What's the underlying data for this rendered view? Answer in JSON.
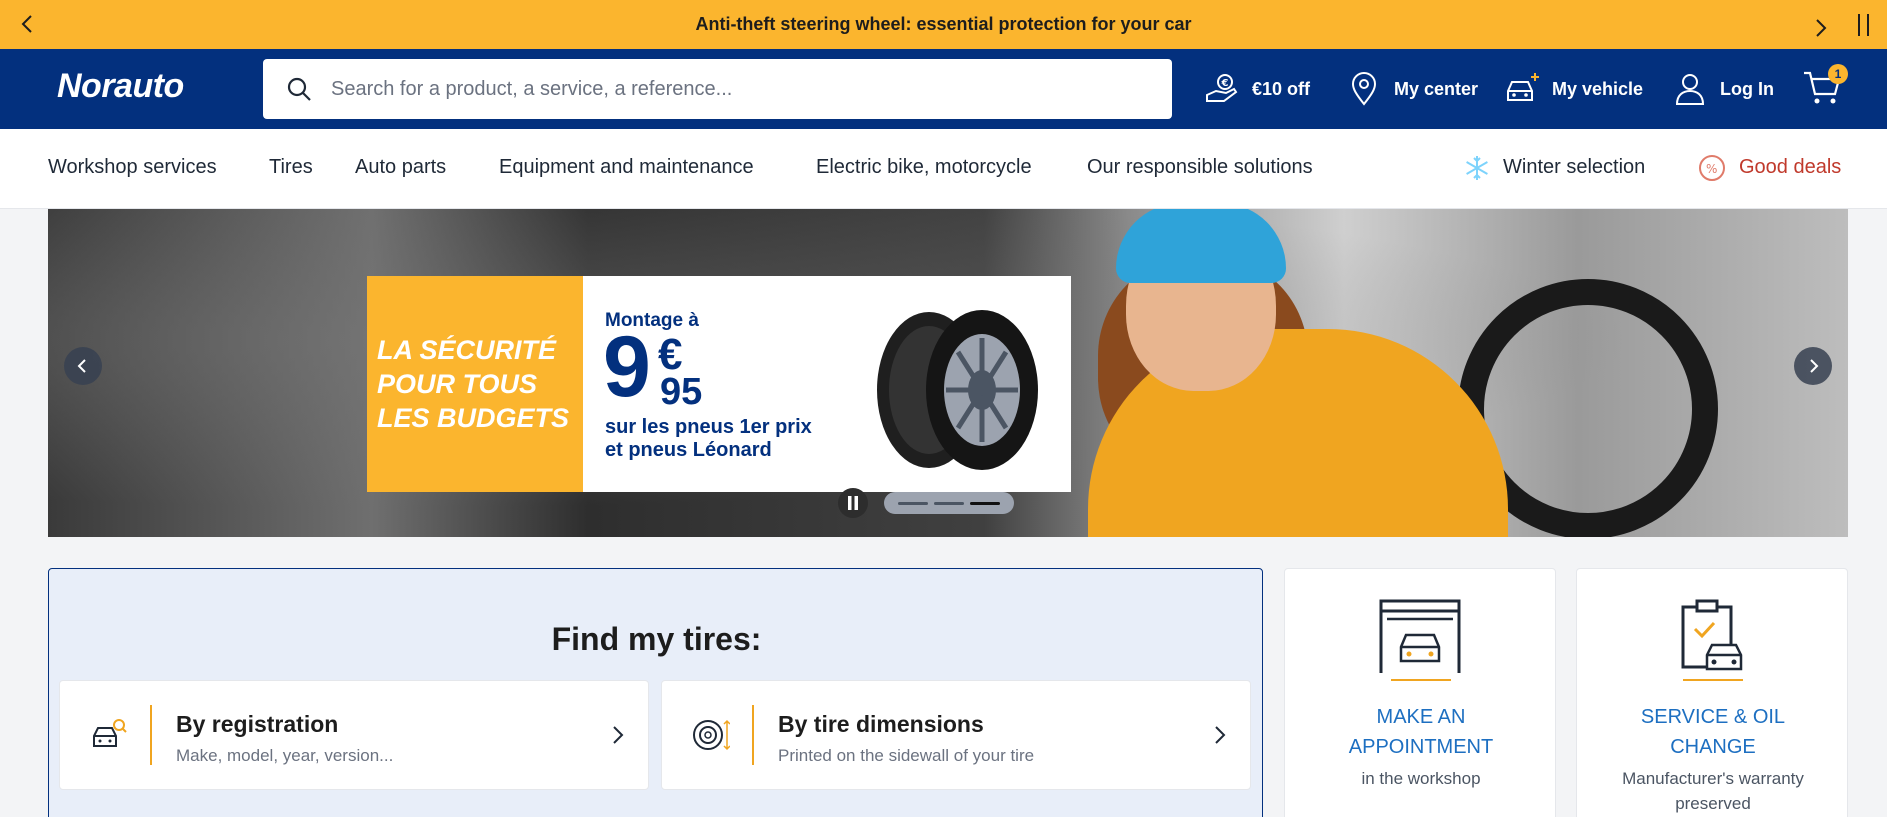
{
  "promo": {
    "text": "Anti-theft steering wheel: essential protection for your car"
  },
  "header": {
    "logo": {
      "main": "Norauto"
    },
    "search_placeholder": "Search for a product, a service, a reference...",
    "items": [
      {
        "label": "€10 off",
        "icon": "euro-hand-icon"
      },
      {
        "label": "My center",
        "icon": "location-pin-icon"
      },
      {
        "label": "My vehicle",
        "icon": "add-car-icon"
      },
      {
        "label": "Log In",
        "icon": "user-icon"
      }
    ],
    "cart_count": "1"
  },
  "nav": {
    "items": [
      "Workshop services",
      "Tires",
      "Auto parts",
      "Equipment and maintenance",
      "Electric bike, motorcycle",
      "Our responsible solutions"
    ],
    "winter": "Winter selection",
    "deals": "Good deals",
    "colors": {
      "deals": "#c0392b",
      "winter_icon": "#7dd3fc"
    }
  },
  "hero": {
    "tagline": "LA SÉCURITÉ\nPOUR TOUS\nLES BUDGETS",
    "pre": "Montage à",
    "price_main": "9",
    "price_currency": "€",
    "price_cents": "95",
    "sub": "sur les pneus 1er prix\net pneus Léonard",
    "slides_total": 3,
    "active_slide": 3
  },
  "finder": {
    "title": "Find my tires:",
    "cards": [
      {
        "title": "By registration",
        "sub": "Make, model, year, version...",
        "icon": "car-search-icon"
      },
      {
        "title": "By tire dimensions",
        "sub": "Printed on the sidewall of your tire",
        "icon": "tire-size-icon"
      }
    ]
  },
  "services": [
    {
      "title": "MAKE AN\nAPPOINTMENT",
      "sub": "in the workshop",
      "icon": "garage-car-icon"
    },
    {
      "title": "SERVICE & OIL\nCHANGE",
      "sub": "Manufacturer's warranty preserved",
      "icon": "clipboard-car-icon"
    }
  ],
  "colors": {
    "brand_blue": "#03307e",
    "brand_yellow": "#fbb52e",
    "link_blue": "#1d6fc1"
  }
}
